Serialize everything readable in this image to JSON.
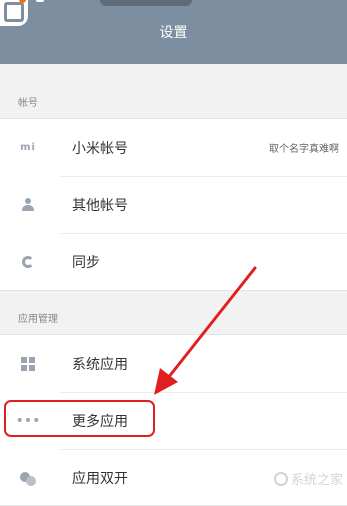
{
  "header": {
    "title": "设置"
  },
  "groups": [
    {
      "label": "帐号",
      "items": [
        {
          "label": "小米帐号",
          "value": "取个名字真难啊",
          "icon": "mi-icon"
        },
        {
          "label": "其他帐号",
          "icon": "person-icon"
        },
        {
          "label": "同步",
          "icon": "sync-icon"
        }
      ]
    },
    {
      "label": "应用管理",
      "items": [
        {
          "label": "系统应用",
          "icon": "grid-icon"
        },
        {
          "label": "更多应用",
          "icon": "more-dots-icon"
        },
        {
          "label": "应用双开",
          "icon": "dual-app-icon"
        }
      ]
    }
  ],
  "watermark": {
    "text": "系统之家"
  },
  "annotation": {
    "color": "#e02020",
    "highlighted_item": "更多应用"
  }
}
